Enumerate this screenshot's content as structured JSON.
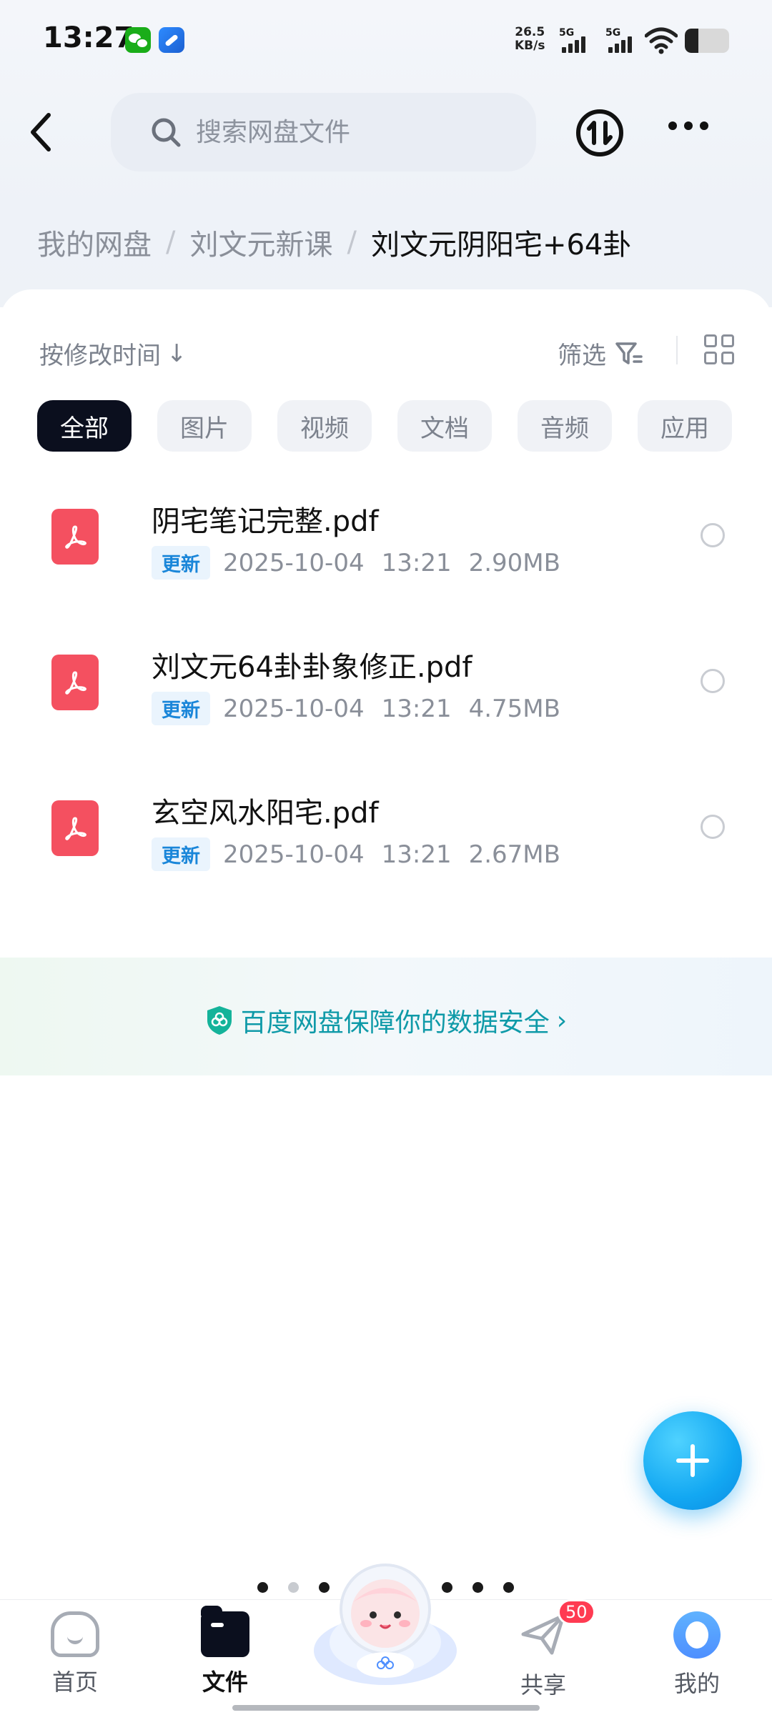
{
  "status_bar": {
    "time": "13:27",
    "net_speed_value": "26.5",
    "net_speed_unit": "KB/s",
    "signal1_label": "5G",
    "signal2_label": "5G",
    "battery_level": 0.3,
    "app_icons": [
      "wechat-icon",
      "browser-icon"
    ]
  },
  "header": {
    "search_placeholder": "搜索网盘文件",
    "icons": [
      "back-icon",
      "search-icon",
      "transfer-icon",
      "more-icon"
    ]
  },
  "breadcrumb": {
    "items": [
      "我的网盘",
      "刘文元新课",
      "刘文元阴阳宅+64卦"
    ],
    "separator": "/"
  },
  "toolbar": {
    "sort_label": "按修改时间",
    "sort_arrow": "↓",
    "filter_label": "筛选"
  },
  "categories": [
    {
      "label": "全部",
      "active": true
    },
    {
      "label": "图片",
      "active": false
    },
    {
      "label": "视频",
      "active": false
    },
    {
      "label": "文档",
      "active": false
    },
    {
      "label": "音频",
      "active": false
    },
    {
      "label": "应用",
      "active": false
    }
  ],
  "files": [
    {
      "name": "阴宅笔记完整.pdf",
      "badge": "更新",
      "date": "2025-10-04",
      "time": "13:21",
      "size": "2.90MB"
    },
    {
      "name": "刘文元64卦卦象修正.pdf",
      "badge": "更新",
      "date": "2025-10-04",
      "time": "13:21",
      "size": "4.75MB"
    },
    {
      "name": "玄空风水阳宅.pdf",
      "badge": "更新",
      "date": "2025-10-04",
      "time": "13:21",
      "size": "2.67MB"
    }
  ],
  "security_banner": {
    "text": "百度网盘保障你的数据安全",
    "chevron": "›"
  },
  "bottom_nav": {
    "items": [
      {
        "label": "首页",
        "icon": "home-icon"
      },
      {
        "label": "文件",
        "icon": "folder-icon",
        "active": true
      },
      {
        "label": "",
        "icon": "mascot-icon"
      },
      {
        "label": "共享",
        "icon": "share-icon",
        "badge": "50"
      },
      {
        "label": "我的",
        "icon": "profile-icon"
      }
    ]
  },
  "colors": {
    "accent": "#13a8f2",
    "pdf_red": "#f45060",
    "badge_blue": "#1a86d9",
    "security_teal": "#0f9aa8",
    "chip_active": "#0b0f1e"
  }
}
